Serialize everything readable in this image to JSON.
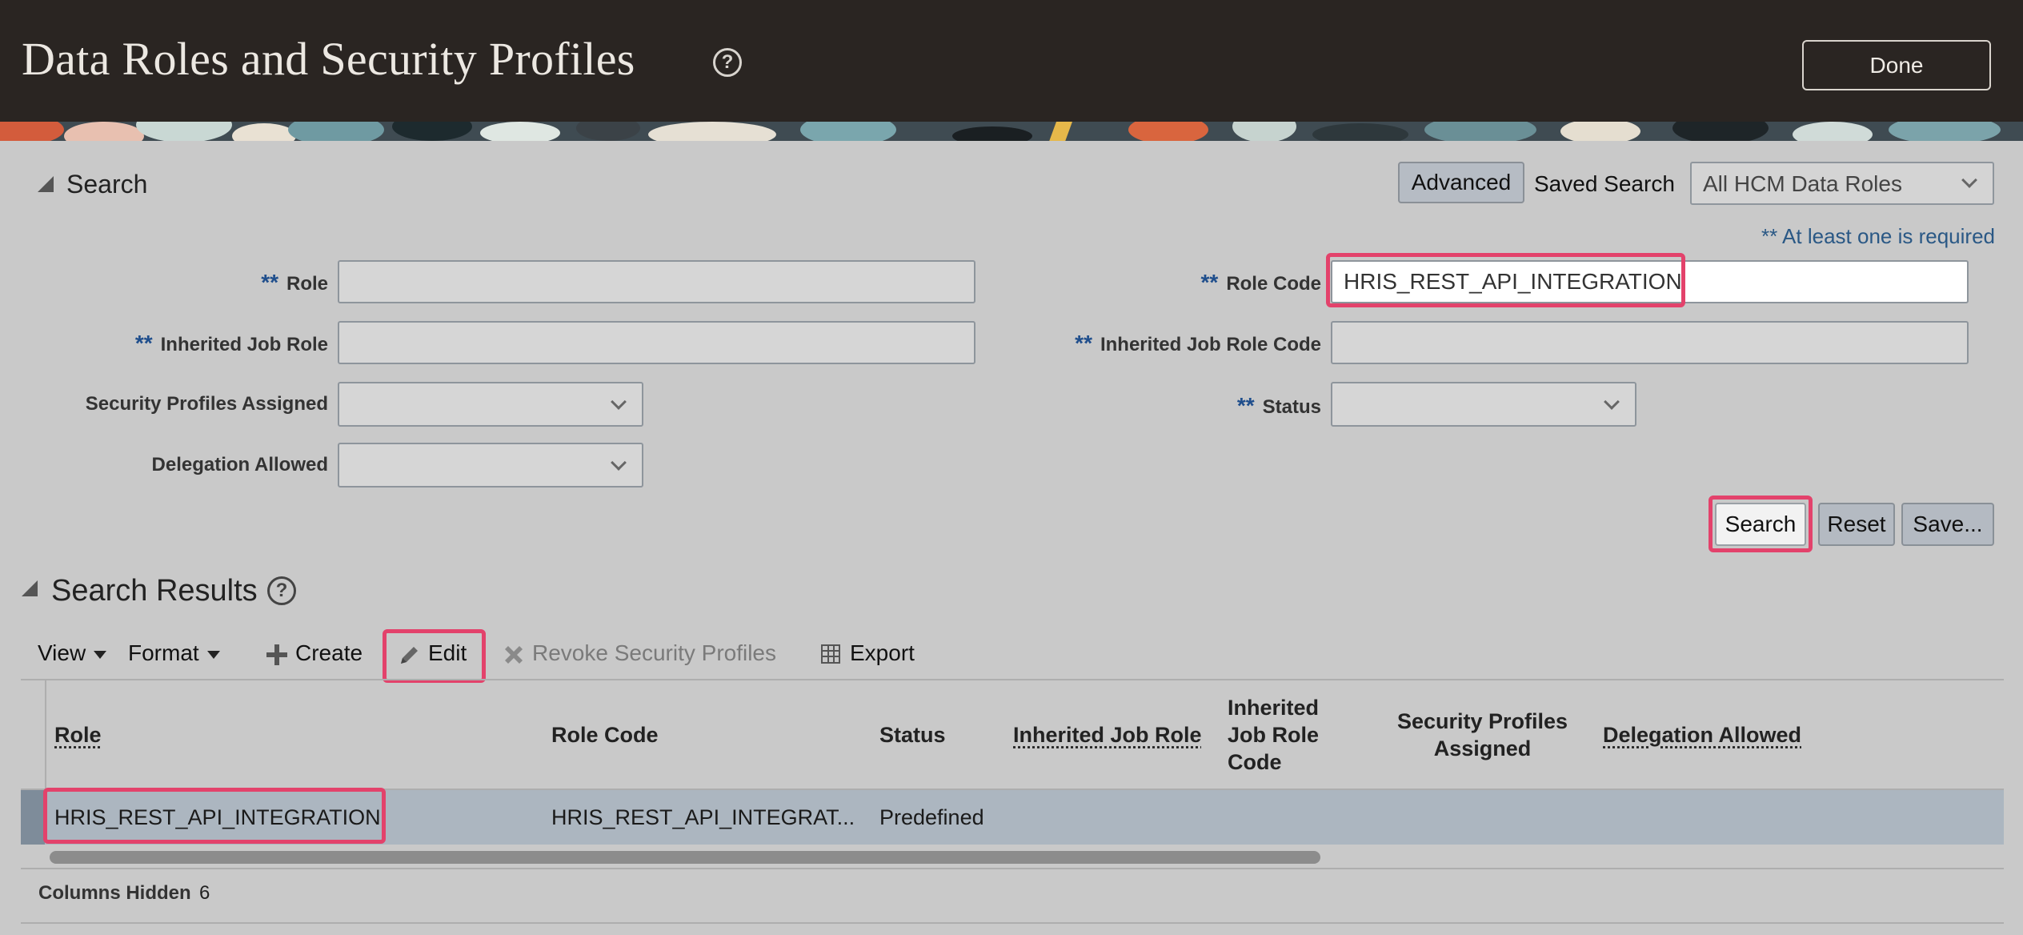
{
  "header": {
    "title": "Data Roles and Security Profiles",
    "help_glyph": "?",
    "done_label": "Done"
  },
  "search": {
    "section_label": "Search",
    "advanced_label": "Advanced",
    "saved_search_label": "Saved Search",
    "saved_search_value": "All HCM Data Roles",
    "required_note": "** At least one is required",
    "required_marker": "**",
    "fields": {
      "role": {
        "label": "Role",
        "value": ""
      },
      "inherited_job_role": {
        "label": "Inherited Job Role",
        "value": ""
      },
      "security_profiles_assigned": {
        "label": "Security Profiles Assigned",
        "value": ""
      },
      "delegation_allowed": {
        "label": "Delegation Allowed",
        "value": ""
      },
      "role_code": {
        "label": "Role Code",
        "value": "HRIS_REST_API_INTEGRATION"
      },
      "inherited_job_role_code": {
        "label": "Inherited Job Role Code",
        "value": ""
      },
      "status": {
        "label": "Status",
        "value": ""
      }
    },
    "buttons": {
      "search": "Search",
      "reset": "Reset",
      "save": "Save..."
    }
  },
  "results": {
    "section_label": "Search Results",
    "toolbar": {
      "view": "View",
      "format": "Format",
      "create": "Create",
      "edit": "Edit",
      "revoke": "Revoke Security Profiles",
      "export": "Export"
    },
    "columns": [
      "Role",
      "Role Code",
      "Status",
      "Inherited Job Role",
      "Inherited Job Role Code",
      "Security Profiles Assigned",
      "Delegation Allowed"
    ],
    "rows": [
      {
        "role": "HRIS_REST_API_INTEGRATION",
        "role_code": "HRIS_REST_API_INTEGRAT...",
        "status": "Predefined"
      }
    ],
    "footer": {
      "columns_hidden_label": "Columns Hidden",
      "columns_hidden_count": "6"
    }
  },
  "colors": {
    "header_bg": "#2a2522",
    "highlight": "#e3426b",
    "required_marker": "#1f4e8c",
    "selected_row": "#acb6c0"
  }
}
